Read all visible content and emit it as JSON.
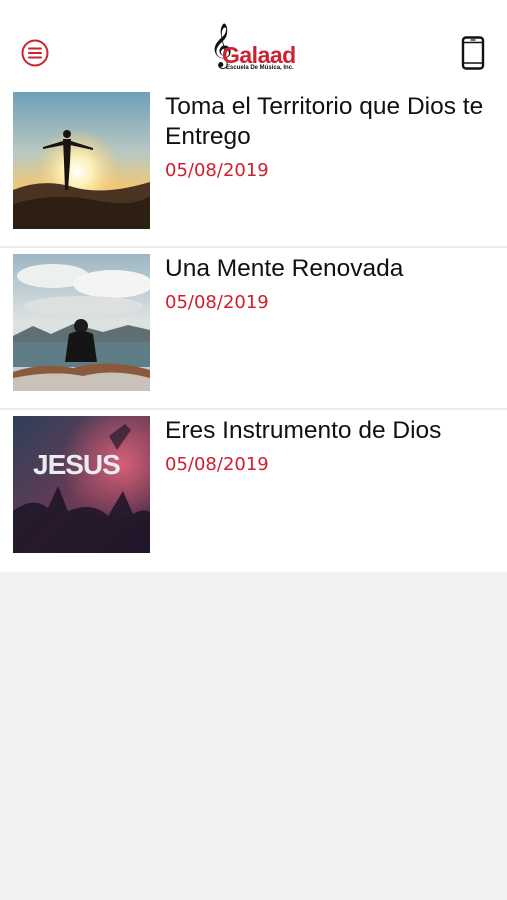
{
  "header": {
    "menu_icon": "hamburger-circle-icon",
    "logo": {
      "name": "Galaad",
      "subtitle": "Escuela De Música, Inc."
    },
    "device_icon": "smartphone-icon"
  },
  "items": [
    {
      "title": "Toma el Territorio que Dios te Entrego",
      "date": "05/08/2019"
    },
    {
      "title": "Una Mente Renovada",
      "date": "05/08/2019"
    },
    {
      "title": "Eres Instrumento de Dios",
      "date": "05/08/2019"
    }
  ],
  "thumb3_text": "JESUS",
  "colors": {
    "accent": "#d0202f",
    "background": "#f2f2f2",
    "card": "#ffffff",
    "text": "#111111"
  }
}
